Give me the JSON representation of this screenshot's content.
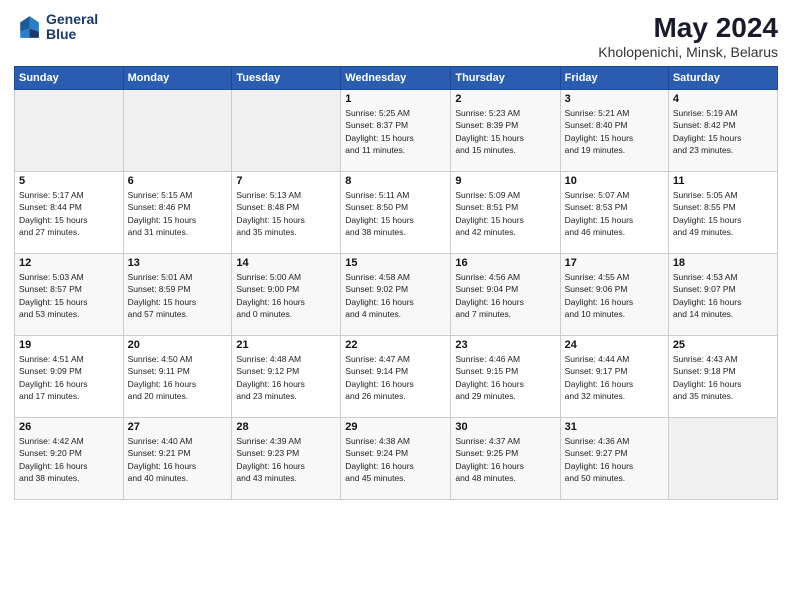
{
  "header": {
    "logo_line1": "General",
    "logo_line2": "Blue",
    "title": "May 2024",
    "subtitle": "Kholopenichi, Minsk, Belarus"
  },
  "weekdays": [
    "Sunday",
    "Monday",
    "Tuesday",
    "Wednesday",
    "Thursday",
    "Friday",
    "Saturday"
  ],
  "weeks": [
    [
      {
        "num": "",
        "info": ""
      },
      {
        "num": "",
        "info": ""
      },
      {
        "num": "",
        "info": ""
      },
      {
        "num": "1",
        "info": "Sunrise: 5:25 AM\nSunset: 8:37 PM\nDaylight: 15 hours\nand 11 minutes."
      },
      {
        "num": "2",
        "info": "Sunrise: 5:23 AM\nSunset: 8:39 PM\nDaylight: 15 hours\nand 15 minutes."
      },
      {
        "num": "3",
        "info": "Sunrise: 5:21 AM\nSunset: 8:40 PM\nDaylight: 15 hours\nand 19 minutes."
      },
      {
        "num": "4",
        "info": "Sunrise: 5:19 AM\nSunset: 8:42 PM\nDaylight: 15 hours\nand 23 minutes."
      }
    ],
    [
      {
        "num": "5",
        "info": "Sunrise: 5:17 AM\nSunset: 8:44 PM\nDaylight: 15 hours\nand 27 minutes."
      },
      {
        "num": "6",
        "info": "Sunrise: 5:15 AM\nSunset: 8:46 PM\nDaylight: 15 hours\nand 31 minutes."
      },
      {
        "num": "7",
        "info": "Sunrise: 5:13 AM\nSunset: 8:48 PM\nDaylight: 15 hours\nand 35 minutes."
      },
      {
        "num": "8",
        "info": "Sunrise: 5:11 AM\nSunset: 8:50 PM\nDaylight: 15 hours\nand 38 minutes."
      },
      {
        "num": "9",
        "info": "Sunrise: 5:09 AM\nSunset: 8:51 PM\nDaylight: 15 hours\nand 42 minutes."
      },
      {
        "num": "10",
        "info": "Sunrise: 5:07 AM\nSunset: 8:53 PM\nDaylight: 15 hours\nand 46 minutes."
      },
      {
        "num": "11",
        "info": "Sunrise: 5:05 AM\nSunset: 8:55 PM\nDaylight: 15 hours\nand 49 minutes."
      }
    ],
    [
      {
        "num": "12",
        "info": "Sunrise: 5:03 AM\nSunset: 8:57 PM\nDaylight: 15 hours\nand 53 minutes."
      },
      {
        "num": "13",
        "info": "Sunrise: 5:01 AM\nSunset: 8:59 PM\nDaylight: 15 hours\nand 57 minutes."
      },
      {
        "num": "14",
        "info": "Sunrise: 5:00 AM\nSunset: 9:00 PM\nDaylight: 16 hours\nand 0 minutes."
      },
      {
        "num": "15",
        "info": "Sunrise: 4:58 AM\nSunset: 9:02 PM\nDaylight: 16 hours\nand 4 minutes."
      },
      {
        "num": "16",
        "info": "Sunrise: 4:56 AM\nSunset: 9:04 PM\nDaylight: 16 hours\nand 7 minutes."
      },
      {
        "num": "17",
        "info": "Sunrise: 4:55 AM\nSunset: 9:06 PM\nDaylight: 16 hours\nand 10 minutes."
      },
      {
        "num": "18",
        "info": "Sunrise: 4:53 AM\nSunset: 9:07 PM\nDaylight: 16 hours\nand 14 minutes."
      }
    ],
    [
      {
        "num": "19",
        "info": "Sunrise: 4:51 AM\nSunset: 9:09 PM\nDaylight: 16 hours\nand 17 minutes."
      },
      {
        "num": "20",
        "info": "Sunrise: 4:50 AM\nSunset: 9:11 PM\nDaylight: 16 hours\nand 20 minutes."
      },
      {
        "num": "21",
        "info": "Sunrise: 4:48 AM\nSunset: 9:12 PM\nDaylight: 16 hours\nand 23 minutes."
      },
      {
        "num": "22",
        "info": "Sunrise: 4:47 AM\nSunset: 9:14 PM\nDaylight: 16 hours\nand 26 minutes."
      },
      {
        "num": "23",
        "info": "Sunrise: 4:46 AM\nSunset: 9:15 PM\nDaylight: 16 hours\nand 29 minutes."
      },
      {
        "num": "24",
        "info": "Sunrise: 4:44 AM\nSunset: 9:17 PM\nDaylight: 16 hours\nand 32 minutes."
      },
      {
        "num": "25",
        "info": "Sunrise: 4:43 AM\nSunset: 9:18 PM\nDaylight: 16 hours\nand 35 minutes."
      }
    ],
    [
      {
        "num": "26",
        "info": "Sunrise: 4:42 AM\nSunset: 9:20 PM\nDaylight: 16 hours\nand 38 minutes."
      },
      {
        "num": "27",
        "info": "Sunrise: 4:40 AM\nSunset: 9:21 PM\nDaylight: 16 hours\nand 40 minutes."
      },
      {
        "num": "28",
        "info": "Sunrise: 4:39 AM\nSunset: 9:23 PM\nDaylight: 16 hours\nand 43 minutes."
      },
      {
        "num": "29",
        "info": "Sunrise: 4:38 AM\nSunset: 9:24 PM\nDaylight: 16 hours\nand 45 minutes."
      },
      {
        "num": "30",
        "info": "Sunrise: 4:37 AM\nSunset: 9:25 PM\nDaylight: 16 hours\nand 48 minutes."
      },
      {
        "num": "31",
        "info": "Sunrise: 4:36 AM\nSunset: 9:27 PM\nDaylight: 16 hours\nand 50 minutes."
      },
      {
        "num": "",
        "info": ""
      }
    ]
  ]
}
